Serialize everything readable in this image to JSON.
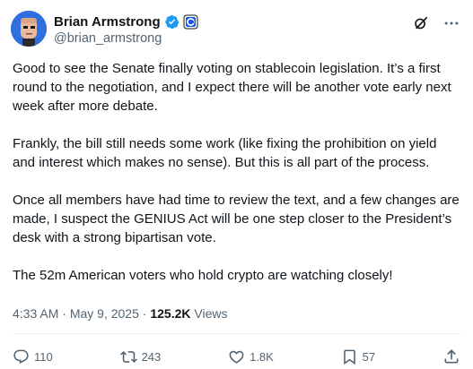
{
  "author": {
    "display_name": "Brian Armstrong",
    "handle": "@brian_armstrong"
  },
  "header_icons": [
    "verified-badge-icon",
    "affiliate-badge-icon",
    "grok-icon",
    "more-options-icon"
  ],
  "tweet": {
    "paragraphs": [
      "Good to see the Senate finally voting on stablecoin legislation. It’s a first round to the negotiation, and I expect there will be another vote early next week after more debate.",
      "Frankly, the bill still needs some work (like fixing the prohibition on yield and interest which makes no sense). But this is all part of the process.",
      "Once all members have had time to review the text, and a few changes are made, I suspect the GENIUS Act will be one step closer to the President’s desk with a strong bipartisan vote.",
      "The 52m American voters who hold crypto are watching closely!"
    ],
    "time": "4:33 AM",
    "separator": "·",
    "date": "May 9, 2025",
    "views_count": "125.2K",
    "views_label": "Views"
  },
  "actions": {
    "replies": "110",
    "reposts": "243",
    "likes": "1.8K",
    "bookmarks": "57"
  },
  "colors": {
    "text": "#0f1419",
    "secondary": "#536471",
    "verified_blue": "#1d9bf0",
    "divider": "#eff3f4"
  }
}
